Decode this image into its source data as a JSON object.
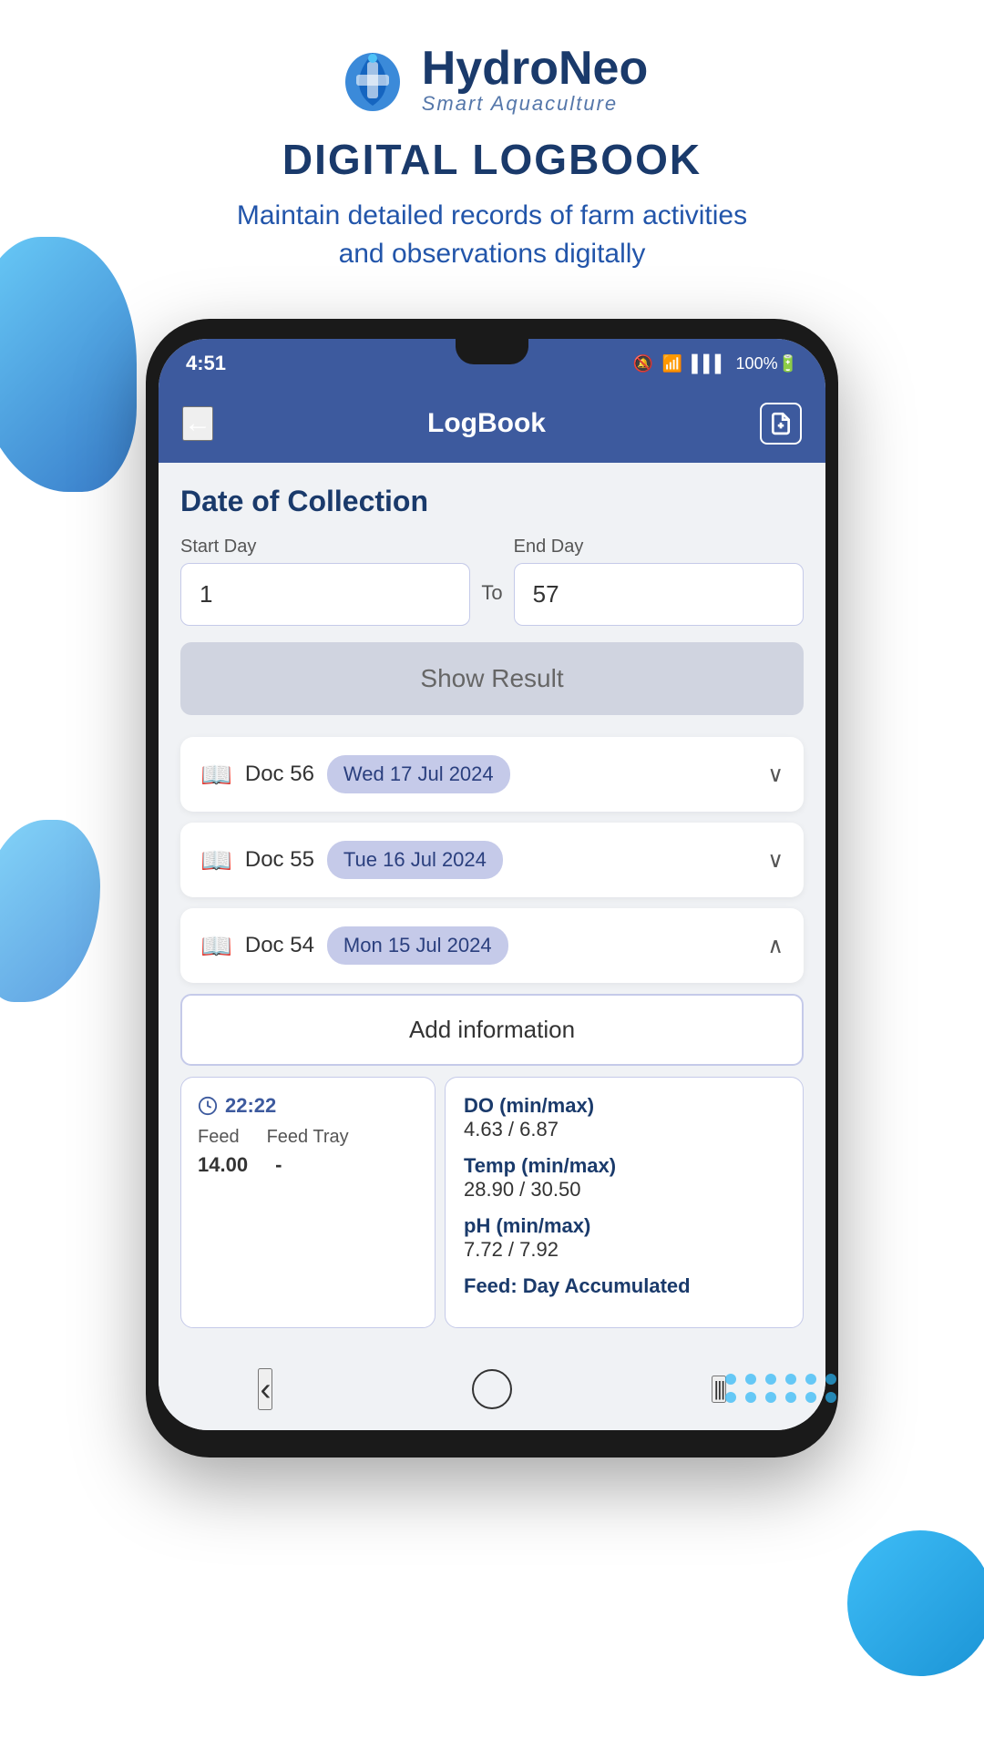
{
  "app": {
    "logo": {
      "name_regular": "Hydro",
      "name_bold": "Neo",
      "tagline": "Smart Aquaculture"
    },
    "page_title": "DIGITAL LOGBOOK",
    "page_subtitle": "Maintain detailed records of farm activities\nand observations digitally"
  },
  "phone": {
    "status_bar": {
      "time": "4:51",
      "icons": "🔕 🛜 📶 100%"
    },
    "app_bar": {
      "title": "LogBook",
      "back_label": "←",
      "add_btn_label": "+"
    },
    "content": {
      "section_title": "Date of Collection",
      "start_day_label": "Start Day",
      "start_day_value": "1",
      "to_label": "To",
      "end_day_label": "End Day",
      "end_day_value": "57",
      "show_result_btn": "Show Result",
      "log_entries": [
        {
          "doc_num": "Doc 56",
          "date": "Wed 17 Jul 2024",
          "expanded": false
        },
        {
          "doc_num": "Doc 55",
          "date": "Tue 16 Jul 2024",
          "expanded": false
        },
        {
          "doc_num": "Doc 54",
          "date": "Mon 15 Jul 2024",
          "expanded": true
        }
      ],
      "add_info_label": "Add information",
      "feed_card": {
        "time": "22:22",
        "col1_header": "Feed",
        "col2_header": "Feed Tray",
        "col1_value": "14.00",
        "col2_value": "-"
      },
      "sensor_card": {
        "do_label": "DO (min/max)",
        "do_value": "4.63 / 6.87",
        "temp_label": "Temp (min/max)",
        "temp_value": "28.90 / 30.50",
        "ph_label": "pH (min/max)",
        "ph_value": "7.72 / 7.92",
        "feed_label": "Feed: Day Accumulated"
      }
    },
    "nav_bar": {
      "back": "‹",
      "home": "○",
      "recent": "▐▐▐"
    }
  }
}
